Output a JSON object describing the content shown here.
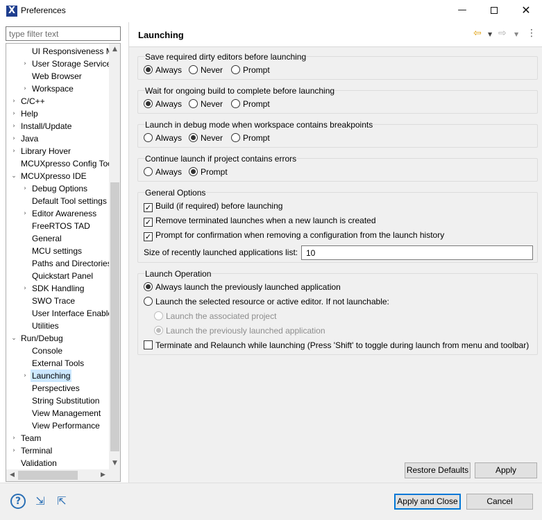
{
  "window": {
    "title": "Preferences",
    "minimize": "—",
    "close": "✕"
  },
  "filter": {
    "placeholder": "type filter text"
  },
  "tree": [
    {
      "label": "UI Responsiveness Mo",
      "level": 2,
      "arrow": ""
    },
    {
      "label": "User Storage Service",
      "level": 2,
      "arrow": "›"
    },
    {
      "label": "Web Browser",
      "level": 2,
      "arrow": ""
    },
    {
      "label": "Workspace",
      "level": 2,
      "arrow": "›"
    },
    {
      "label": "C/C++",
      "level": 1,
      "arrow": "›"
    },
    {
      "label": "Help",
      "level": 1,
      "arrow": "›"
    },
    {
      "label": "Install/Update",
      "level": 1,
      "arrow": "›"
    },
    {
      "label": "Java",
      "level": 1,
      "arrow": "›"
    },
    {
      "label": "Library Hover",
      "level": 1,
      "arrow": "›"
    },
    {
      "label": "MCUXpresso Config Too",
      "level": 1,
      "arrow": ""
    },
    {
      "label": "MCUXpresso IDE",
      "level": 1,
      "arrow": "⌄"
    },
    {
      "label": "Debug Options",
      "level": 2,
      "arrow": "›"
    },
    {
      "label": "Default Tool settings",
      "level": 2,
      "arrow": ""
    },
    {
      "label": "Editor Awareness",
      "level": 2,
      "arrow": "›"
    },
    {
      "label": "FreeRTOS TAD",
      "level": 2,
      "arrow": ""
    },
    {
      "label": "General",
      "level": 2,
      "arrow": ""
    },
    {
      "label": "MCU settings",
      "level": 2,
      "arrow": ""
    },
    {
      "label": "Paths and Directories",
      "level": 2,
      "arrow": ""
    },
    {
      "label": "Quickstart Panel",
      "level": 2,
      "arrow": ""
    },
    {
      "label": "SDK Handling",
      "level": 2,
      "arrow": "›"
    },
    {
      "label": "SWO Trace",
      "level": 2,
      "arrow": ""
    },
    {
      "label": "User Interface Enable",
      "level": 2,
      "arrow": ""
    },
    {
      "label": "Utilities",
      "level": 2,
      "arrow": ""
    },
    {
      "label": "Run/Debug",
      "level": 1,
      "arrow": "⌄"
    },
    {
      "label": "Console",
      "level": 2,
      "arrow": ""
    },
    {
      "label": "External Tools",
      "level": 2,
      "arrow": ""
    },
    {
      "label": "Launching",
      "level": 2,
      "arrow": "›",
      "selected": true
    },
    {
      "label": "Perspectives",
      "level": 2,
      "arrow": ""
    },
    {
      "label": "String Substitution",
      "level": 2,
      "arrow": ""
    },
    {
      "label": "View Management",
      "level": 2,
      "arrow": ""
    },
    {
      "label": "View Performance",
      "level": 2,
      "arrow": ""
    },
    {
      "label": "Team",
      "level": 1,
      "arrow": "›"
    },
    {
      "label": "Terminal",
      "level": 1,
      "arrow": "›"
    },
    {
      "label": "Validation",
      "level": 1,
      "arrow": ""
    }
  ],
  "page": {
    "title": "Launching"
  },
  "groups": {
    "save": {
      "title": "Save required dirty editors before launching",
      "always": "Always",
      "never": "Never",
      "prompt": "Prompt",
      "selected": "Always"
    },
    "wait": {
      "title": "Wait for ongoing build to complete before launching",
      "always": "Always",
      "never": "Never",
      "prompt": "Prompt",
      "selected": "Always"
    },
    "debug": {
      "title": "Launch in debug mode when workspace contains breakpoints",
      "always": "Always",
      "never": "Never",
      "prompt": "Prompt",
      "selected": "Never"
    },
    "errors": {
      "title": "Continue launch if project contains errors",
      "always": "Always",
      "prompt": "Prompt",
      "selected": "Prompt"
    },
    "general": {
      "title": "General Options",
      "build": {
        "label": "Build (if required) before launching",
        "checked": true
      },
      "remove": {
        "label": "Remove terminated launches when a new launch is created",
        "checked": true
      },
      "confirm": {
        "label": "Prompt for confirmation when removing a configuration from the launch history",
        "checked": true
      },
      "size_label": "Size of recently launched applications list:",
      "size_value": "10"
    },
    "operation": {
      "title": "Launch Operation",
      "previous": {
        "label": "Always launch the previously launched application",
        "checked": true
      },
      "selected_resource": {
        "label": "Launch the selected resource or active editor. If not launchable:",
        "checked": false
      },
      "associated": {
        "label": "Launch the associated project",
        "checked": false,
        "enabled": false
      },
      "prev_launched": {
        "label": "Launch the previously launched application",
        "checked": true,
        "enabled": false
      },
      "terminate": {
        "label": "Terminate and Relaunch while launching (Press 'Shift' to toggle during launch from menu and toolbar)",
        "checked": false
      }
    }
  },
  "buttons": {
    "restore": "Restore Defaults",
    "apply": "Apply",
    "apply_close": "Apply and Close",
    "cancel": "Cancel"
  },
  "footer": {
    "help_glyph": "?",
    "import_glyph": "⇲",
    "export_glyph": "⇱"
  },
  "colors": {
    "selection": "#cce8ff",
    "default_button_border": "#0078d7",
    "icon_blue": "#2a6fb5",
    "back_arrow": "#e0a010"
  }
}
